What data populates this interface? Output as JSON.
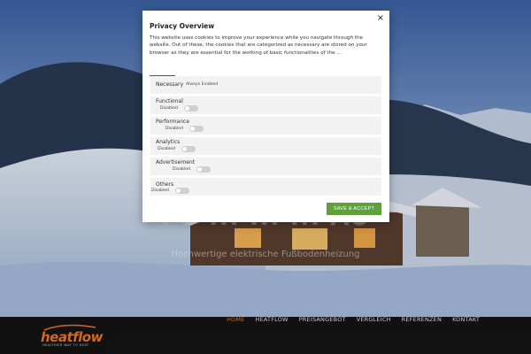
{
  "modal": {
    "title": "Privacy Overview",
    "close_icon": "×",
    "description": "This website uses cookies to improve your experience while you navigate through the website. Out of these, the cookies that are categorized as necessary are stored on your browser as they are essential for the working of basic functionalities of the ...",
    "categories": [
      {
        "label": "Necessary",
        "status": "Always Enabled",
        "has_toggle": false
      },
      {
        "label": "Functional",
        "status": "Disabled",
        "has_toggle": true
      },
      {
        "label": "Performance",
        "status": "Disabled",
        "has_toggle": true
      },
      {
        "label": "Analytics",
        "status": "Disabled",
        "has_toggle": true
      },
      {
        "label": "Advertisement",
        "status": "Disabled",
        "has_toggle": true
      },
      {
        "label": "Others",
        "status": "Disabled",
        "has_toggle": true
      }
    ],
    "save_label": "SAVE & ACCEPT",
    "save_color": "#5fa03c"
  },
  "hero": {
    "line1": "INI ... ... ... ING",
    "line2": "FU ... ... ... AU",
    "subtitle": "Hochwertige elektrische Fußbodenheizung"
  },
  "brand": {
    "name": "heatflow",
    "tagline": "HEALTHIER WAY TO HEAT",
    "accent": "#f07820"
  },
  "nav": {
    "items": [
      "HOME",
      "HEATFLOW",
      "PREISANGEBOT",
      "VERGLEICH",
      "REFERENZEN",
      "KONTAKT"
    ],
    "active": "HOME"
  }
}
